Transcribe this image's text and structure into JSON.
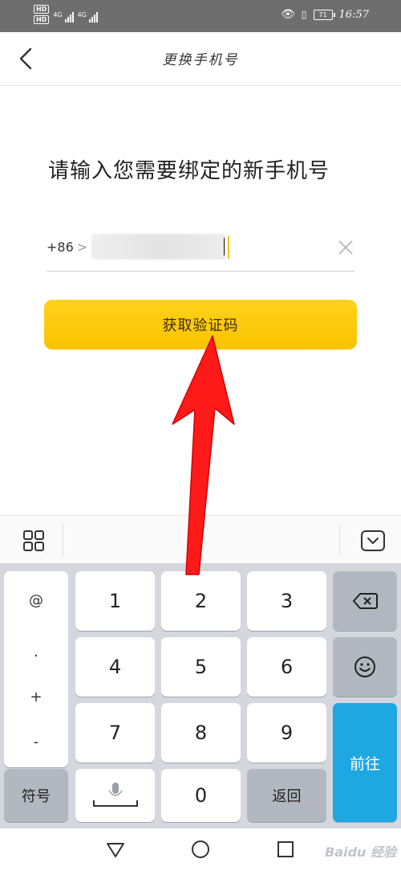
{
  "status_bar": {
    "hd_top": "HD",
    "hd_bottom": "HD",
    "net1": "4G",
    "net2": "4G",
    "battery": "71",
    "time": "16:57"
  },
  "header": {
    "title": "更换手机号"
  },
  "main": {
    "prompt": "请输入您需要绑定的新手机号",
    "country_code": "+86",
    "country_chevron": ">",
    "get_code_button": "获取验证码"
  },
  "keyboard": {
    "symbols": [
      "@",
      ".",
      "+",
      "-"
    ],
    "digits": [
      "1",
      "2",
      "3",
      "4",
      "5",
      "6",
      "7",
      "8",
      "9",
      "0"
    ],
    "symbol_key": "符号",
    "return_key": "返回",
    "go_key": "前往",
    "icons": {
      "menu": "grid-icon",
      "hide": "keyboard-hide-icon",
      "backspace": "backspace-icon",
      "emoji": "emoji-icon",
      "voice": "microphone-icon"
    }
  },
  "system_nav": {
    "back": "triangle-back-icon",
    "home": "circle-home-icon",
    "recent": "square-recent-icon"
  },
  "watermark": "Baidu 经验",
  "colors": {
    "accent_yellow": "#f9c200",
    "go_blue": "#1ea7e1",
    "annotation_red": "#ff1a1a"
  }
}
